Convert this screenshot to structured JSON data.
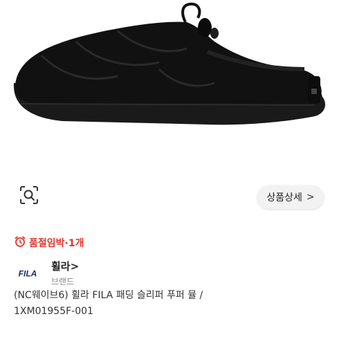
{
  "product": {
    "image_alt": "black padded slipper"
  },
  "actions": {
    "detail_label": "상품상세",
    "detail_chevron": ">"
  },
  "stock": {
    "text": "품절임박·1개"
  },
  "brand": {
    "logo_text": "FILA",
    "name": "휠라",
    "name_chevron": ">",
    "sub_label": "브랜드"
  },
  "title": {
    "line1": "(NC웨이브6) 휠라 FILA 패딩 슬리퍼 푸퍼 뮬 /",
    "line2": "1XM01955F-001"
  },
  "colors": {
    "accent_red": "#e0342c",
    "text_gray": "#888888",
    "brand_navy": "#1a2a6c"
  }
}
